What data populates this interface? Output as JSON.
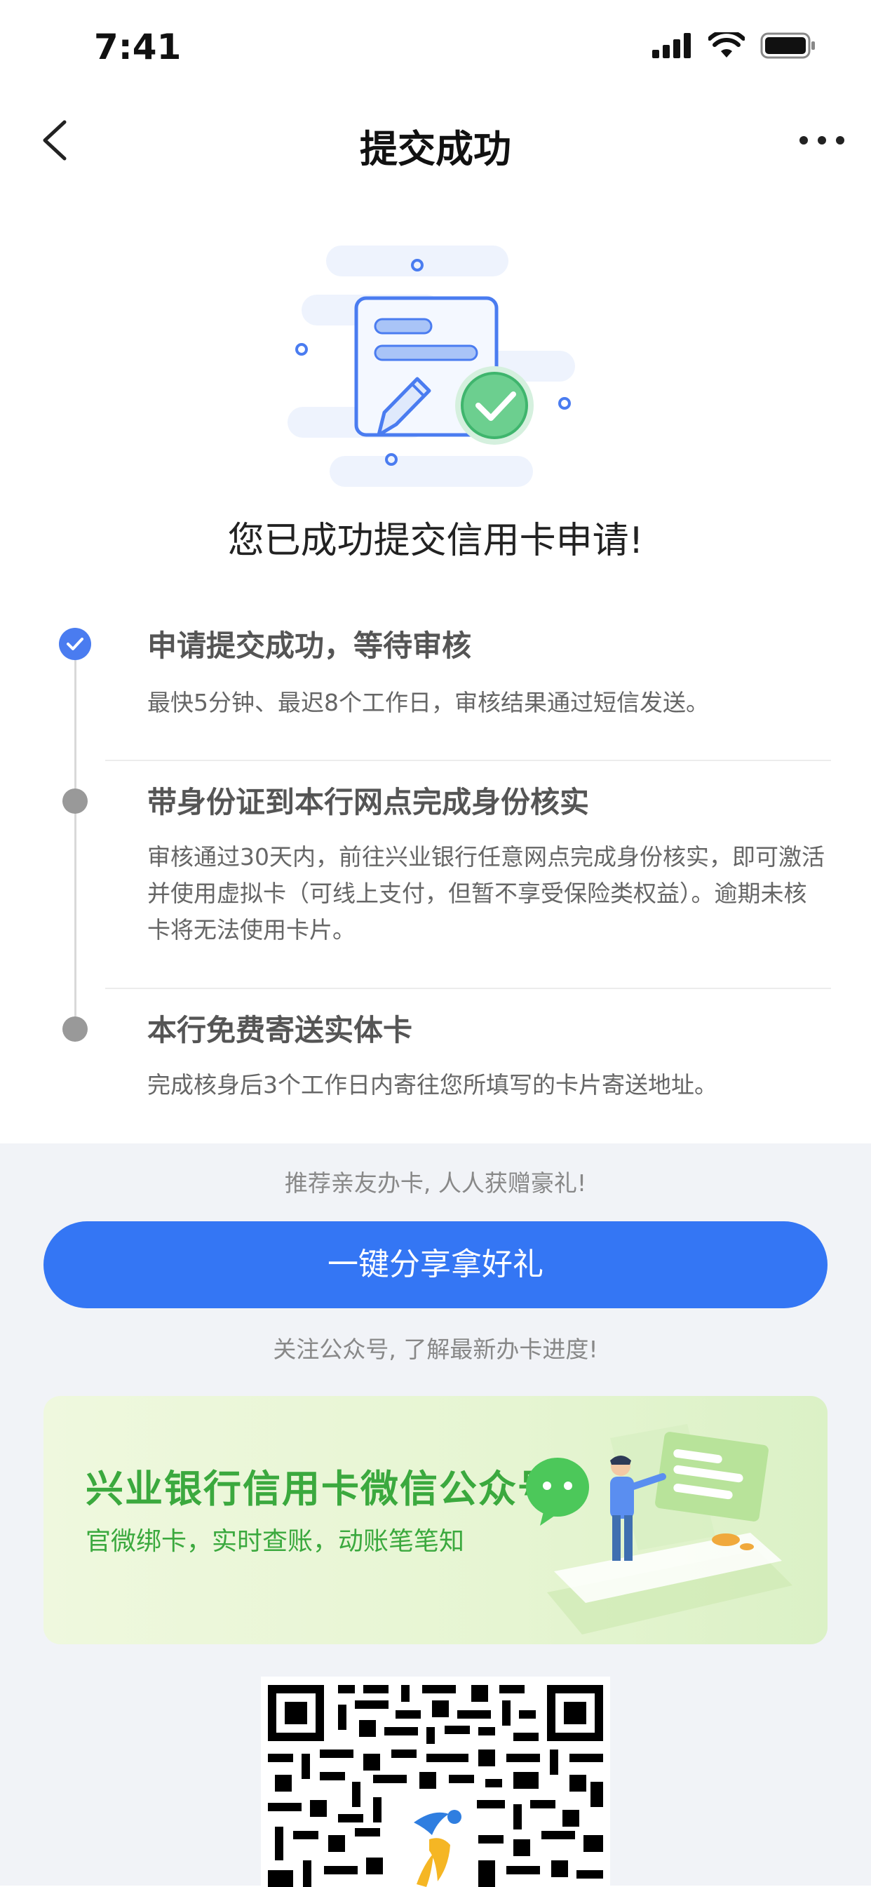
{
  "status_bar": {
    "time": "7:41"
  },
  "nav": {
    "title": "提交成功"
  },
  "headline": "您已成功提交信用卡申请!",
  "steps": [
    {
      "title": "申请提交成功，等待审核",
      "desc": "最快5分钟、最迟8个工作日，审核结果通过短信发送。",
      "status": "done"
    },
    {
      "title": "带身份证到本行网点完成身份核实",
      "desc": "审核通过30天内，前往兴业银行任意网点完成身份核实，即可激活并使用虚拟卡（可线上支付，但暂不享受保险类权益）。逾期未核卡将无法使用卡片。",
      "status": "pending"
    },
    {
      "title": "本行免费寄送实体卡",
      "desc": "完成核身后3个工作日内寄往您所填写的卡片寄送地址。",
      "status": "pending"
    }
  ],
  "recommend_text": "推荐亲友办卡, 人人获赠豪礼!",
  "share_button": "一键分享拿好礼",
  "follow_text": "关注公众号, 了解最新办卡进度!",
  "wechat_card": {
    "title": "兴业银行信用卡微信公众号",
    "subtitle": "官微绑卡，实时查账，动账笔笔知"
  },
  "colors": {
    "primary": "#3476f4",
    "green": "#3ba93e",
    "done_dot": "#4a7cf0"
  }
}
